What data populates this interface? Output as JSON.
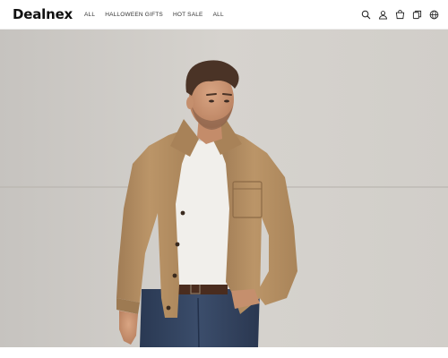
{
  "header": {
    "logo": "Dealnex",
    "nav": [
      {
        "label": "ALL"
      },
      {
        "label": "HALLOWEEN GIFTS"
      },
      {
        "label": "HOT SALE"
      },
      {
        "label": "ALL"
      }
    ],
    "icons": [
      "search-icon",
      "account-icon",
      "cart-icon",
      "compare-icon",
      "globe-icon"
    ]
  },
  "hero": {
    "image": "man-in-tan-jacket-photo",
    "colors": {
      "wall": "#d3d0cb",
      "jacket": "#b48e64",
      "shirt": "#f2f0ec",
      "jeans": "#2f3f58"
    }
  }
}
